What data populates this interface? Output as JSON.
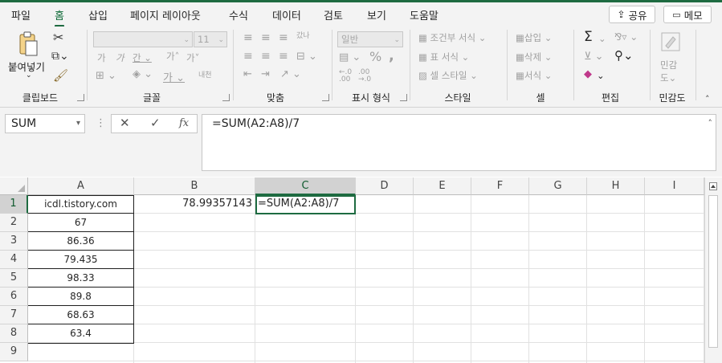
{
  "menu": {
    "tabs": [
      "파일",
      "홈",
      "삽입",
      "페이지 레이아웃",
      "수식",
      "데이터",
      "검토",
      "보기",
      "도움말"
    ],
    "share_label": "공유",
    "memo_label": "메모"
  },
  "ribbon": {
    "clipboard": {
      "paste_label": "붙여넣기",
      "group_label": "클립보드"
    },
    "font": {
      "font_name": "",
      "font_size": "11",
      "group_label": "글꼴",
      "phonetic": "내천"
    },
    "alignment": {
      "wrap": "갔나",
      "group_label": "맞춤"
    },
    "number": {
      "format": "일반",
      "group_label": "표시 형식"
    },
    "styles": {
      "conditional": "조건부 서식",
      "table": "표 서식",
      "cell": "셀 스타일",
      "group_label": "스타일"
    },
    "cells": {
      "insert": "삽입",
      "delete": "삭제",
      "format": "서식",
      "group_label": "셀"
    },
    "editing": {
      "group_label": "편집"
    },
    "sensitivity": {
      "label": "민감",
      "label2": "도",
      "group_label": "민감도"
    }
  },
  "formula_bar": {
    "name_box": "SUM",
    "formula": "=SUM(A2:A8)/7",
    "cancel_icon": "✕",
    "enter_icon": "✓",
    "fx_label": "fx"
  },
  "grid": {
    "columns": [
      "A",
      "B",
      "C",
      "D",
      "E",
      "F",
      "G",
      "H",
      "I"
    ],
    "rows": [
      "1",
      "2",
      "3",
      "4",
      "5",
      "6",
      "7",
      "8",
      "9"
    ],
    "cells": {
      "A1": "icdl.tistory.com",
      "A2": "67",
      "A3": "86.36",
      "A4": "79.435",
      "A5": "98.33",
      "A6": "89.8",
      "A7": "68.63",
      "A8": "63.4",
      "B1": "78.99357143",
      "C1": "=SUM(A2:A8)/7"
    }
  }
}
